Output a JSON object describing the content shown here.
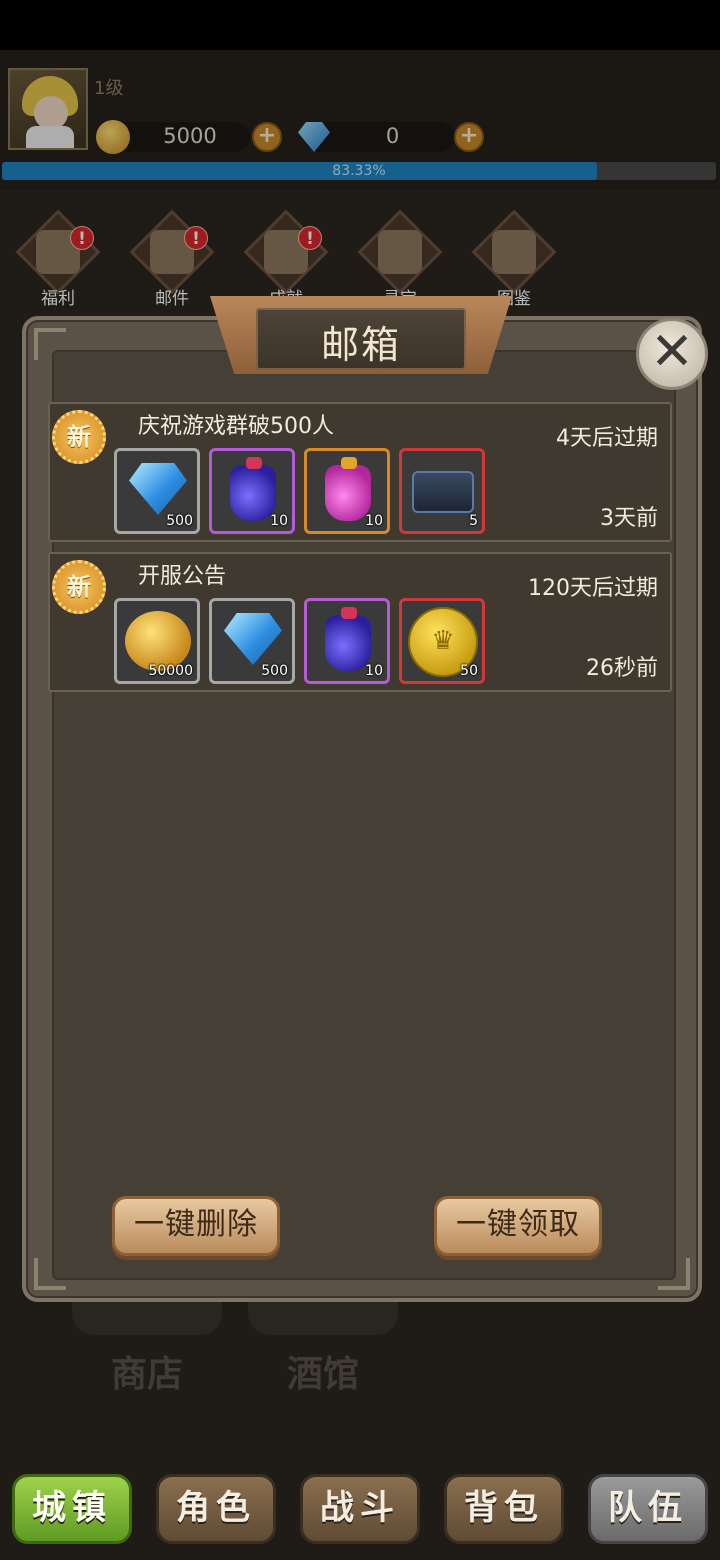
{
  "hud": {
    "level": "1级",
    "gold": "5000",
    "gems": "0",
    "xp_text": "83.33%",
    "xp_fraction": 0.8333
  },
  "top_menu": [
    {
      "label": "福利",
      "icon": "laurel-icon",
      "alert": "!"
    },
    {
      "label": "邮件",
      "icon": "envelope-icon",
      "alert": "!"
    },
    {
      "label": "成就",
      "icon": "trophy-icon",
      "alert": "!"
    },
    {
      "label": "寻宝",
      "icon": "chest-icon",
      "alert": ""
    },
    {
      "label": "图鉴",
      "icon": "book-icon",
      "alert": ""
    }
  ],
  "town": {
    "shop_label": "商店",
    "tavern_label": "酒馆"
  },
  "mailbox": {
    "title": "邮箱",
    "close_icon": "close-icon",
    "new_badge": "新",
    "mails": [
      {
        "title": "庆祝游戏群破500人",
        "expire": "4天后过期",
        "time": "3天前",
        "items": [
          {
            "icon": "gem-icon",
            "count": "500",
            "rarity": "gray"
          },
          {
            "icon": "blue-potion-icon",
            "count": "10",
            "rarity": "purple"
          },
          {
            "icon": "pink-potion-icon",
            "count": "10",
            "rarity": "orange"
          },
          {
            "icon": "chest-icon",
            "count": "5",
            "rarity": "red"
          }
        ]
      },
      {
        "title": "开服公告",
        "expire": "120天后过期",
        "time": "26秒前",
        "items": [
          {
            "icon": "gold-coins-icon",
            "count": "50000",
            "rarity": "gray"
          },
          {
            "icon": "gem-icon",
            "count": "500",
            "rarity": "gray"
          },
          {
            "icon": "blue-potion-icon",
            "count": "10",
            "rarity": "purple"
          },
          {
            "icon": "crown-coin-icon",
            "count": "50",
            "rarity": "red"
          }
        ]
      }
    ],
    "delete_all_label": "一键删除",
    "claim_all_label": "一键领取"
  },
  "bottom_nav": [
    {
      "label": "城镇",
      "active": true
    },
    {
      "label": "角色",
      "active": false
    },
    {
      "label": "战斗",
      "active": false
    },
    {
      "label": "背包",
      "active": false
    },
    {
      "label": "队伍",
      "active": false
    }
  ]
}
